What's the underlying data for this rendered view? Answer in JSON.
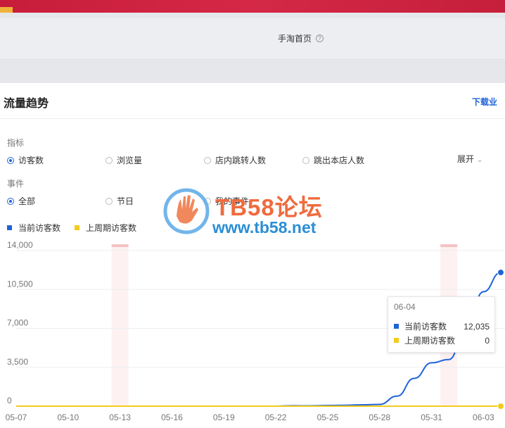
{
  "header": {
    "nav_title": "手淘首页",
    "help_icon": "?"
  },
  "panel": {
    "title": "流量趋势",
    "download_label": "下载业"
  },
  "metrics": {
    "label": "指标",
    "options": [
      "访客数",
      "浏览量",
      "店内跳转人数",
      "跳出本店人数"
    ],
    "selected_index": 0,
    "expand_label": "展开"
  },
  "events": {
    "label": "事件",
    "options": [
      "全部",
      "节日",
      "我的事件"
    ],
    "selected_index": 0
  },
  "legend": [
    {
      "label": "当前访客数",
      "color": "#1f63d9"
    },
    {
      "label": "上周期访客数",
      "color": "#f2cb1d"
    }
  ],
  "watermark": {
    "title": "TB58论坛",
    "url": "www.tb58.net"
  },
  "tooltip": {
    "date": "06-04",
    "rows": [
      {
        "label": "当前访客数",
        "value": "12,035",
        "color": "#1f63d9"
      },
      {
        "label": "上周期访客数",
        "value": "0",
        "color": "#f2cb1d"
      }
    ]
  },
  "chart_data": {
    "type": "line",
    "y_ticks": [
      "0",
      "3,500",
      "7,000",
      "10,500",
      "14,000"
    ],
    "ylim": [
      0,
      14000
    ],
    "x_tick_labels": [
      "05-07",
      "05-10",
      "05-13",
      "05-16",
      "05-19",
      "05-22",
      "05-25",
      "05-28",
      "05-31",
      "06-03"
    ],
    "x": [
      "05-07",
      "05-08",
      "05-09",
      "05-10",
      "05-11",
      "05-12",
      "05-13",
      "05-14",
      "05-15",
      "05-16",
      "05-17",
      "05-18",
      "05-19",
      "05-20",
      "05-21",
      "05-22",
      "05-23",
      "05-24",
      "05-25",
      "05-26",
      "05-27",
      "05-28",
      "05-29",
      "05-30",
      "05-31",
      "06-01",
      "06-02",
      "06-03",
      "06-04"
    ],
    "series": [
      {
        "name": "当前访客数",
        "color": "#1f63d9",
        "values": [
          0,
          0,
          0,
          0,
          0,
          0,
          0,
          0,
          0,
          0,
          0,
          0,
          0,
          0,
          0,
          0,
          40,
          30,
          60,
          80,
          120,
          160,
          900,
          2500,
          3900,
          4200,
          7000,
          10300,
          12035
        ]
      },
      {
        "name": "上周期访客数",
        "color": "#f2cb1d",
        "values": [
          0,
          0,
          0,
          0,
          0,
          0,
          0,
          0,
          0,
          0,
          0,
          0,
          0,
          0,
          0,
          0,
          0,
          0,
          0,
          0,
          0,
          0,
          0,
          0,
          0,
          0,
          0,
          0,
          0
        ]
      }
    ],
    "event_dates": [
      "05-13",
      "06-01"
    ],
    "highlight_date": "06-04",
    "grid": true
  }
}
